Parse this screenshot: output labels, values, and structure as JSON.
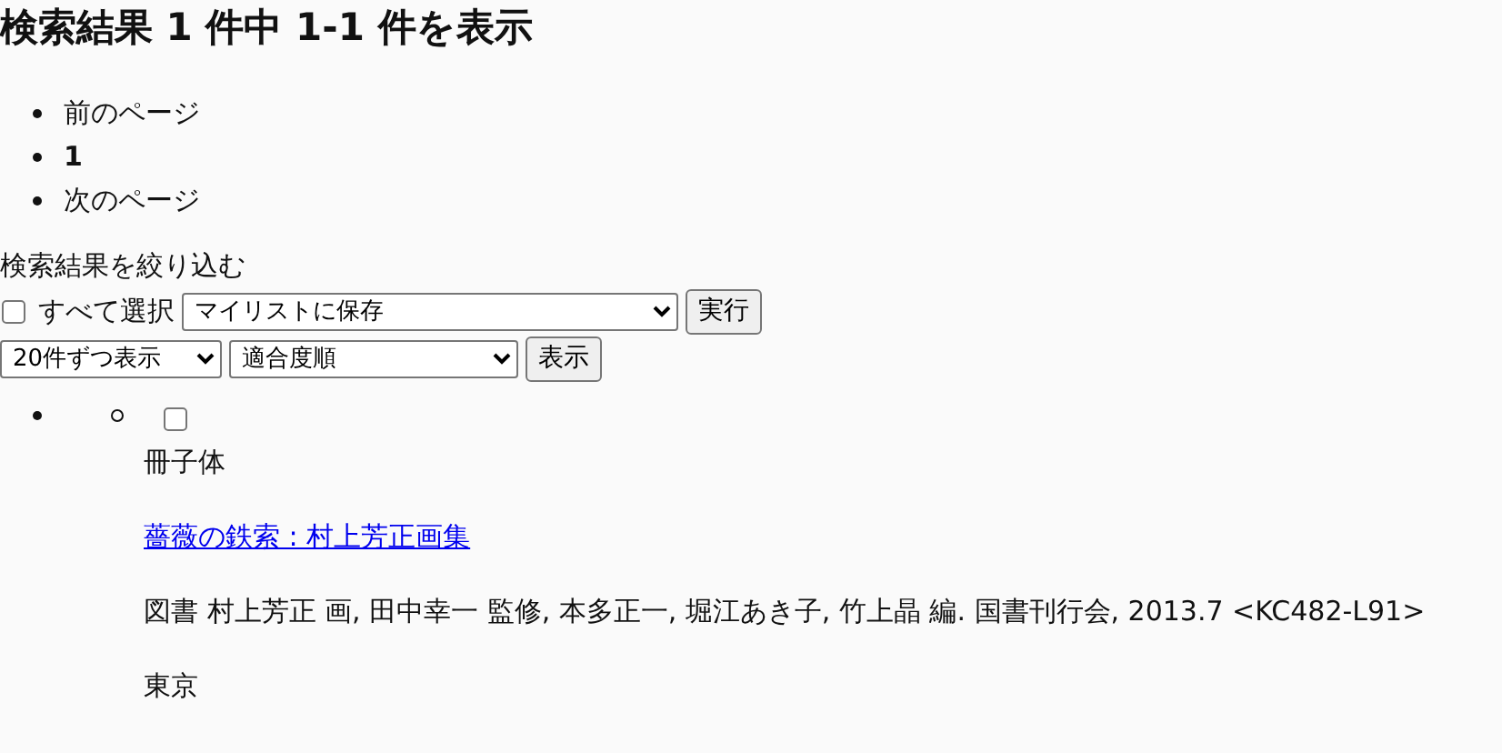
{
  "heading": "検索結果 1 件中 1-1 件を表示",
  "pagination": [
    {
      "label": "前のページ",
      "selected": false
    },
    {
      "label": "1",
      "selected": true
    },
    {
      "label": "次のページ",
      "selected": false
    }
  ],
  "refine_label": "検索結果を絞り込む",
  "select_all": {
    "label": "すべて選択",
    "checked": false
  },
  "action_select": {
    "value": "マイリストに保存"
  },
  "action_button": "実行",
  "per_page_select": {
    "value": "20件ずつ表示"
  },
  "sort_select": {
    "value": "適合度順"
  },
  "display_button": "表示",
  "results": [
    {
      "checked": false,
      "format": "冊子体",
      "title": "薔薇の鉄索 : 村上芳正画集",
      "description": "図書 村上芳正 画, 田中幸一 監修, 本多正一, 堀江あき子, 竹上晶 編. 国書刊行会, 2013.7 <KC482-L91>",
      "place": "東京"
    }
  ]
}
